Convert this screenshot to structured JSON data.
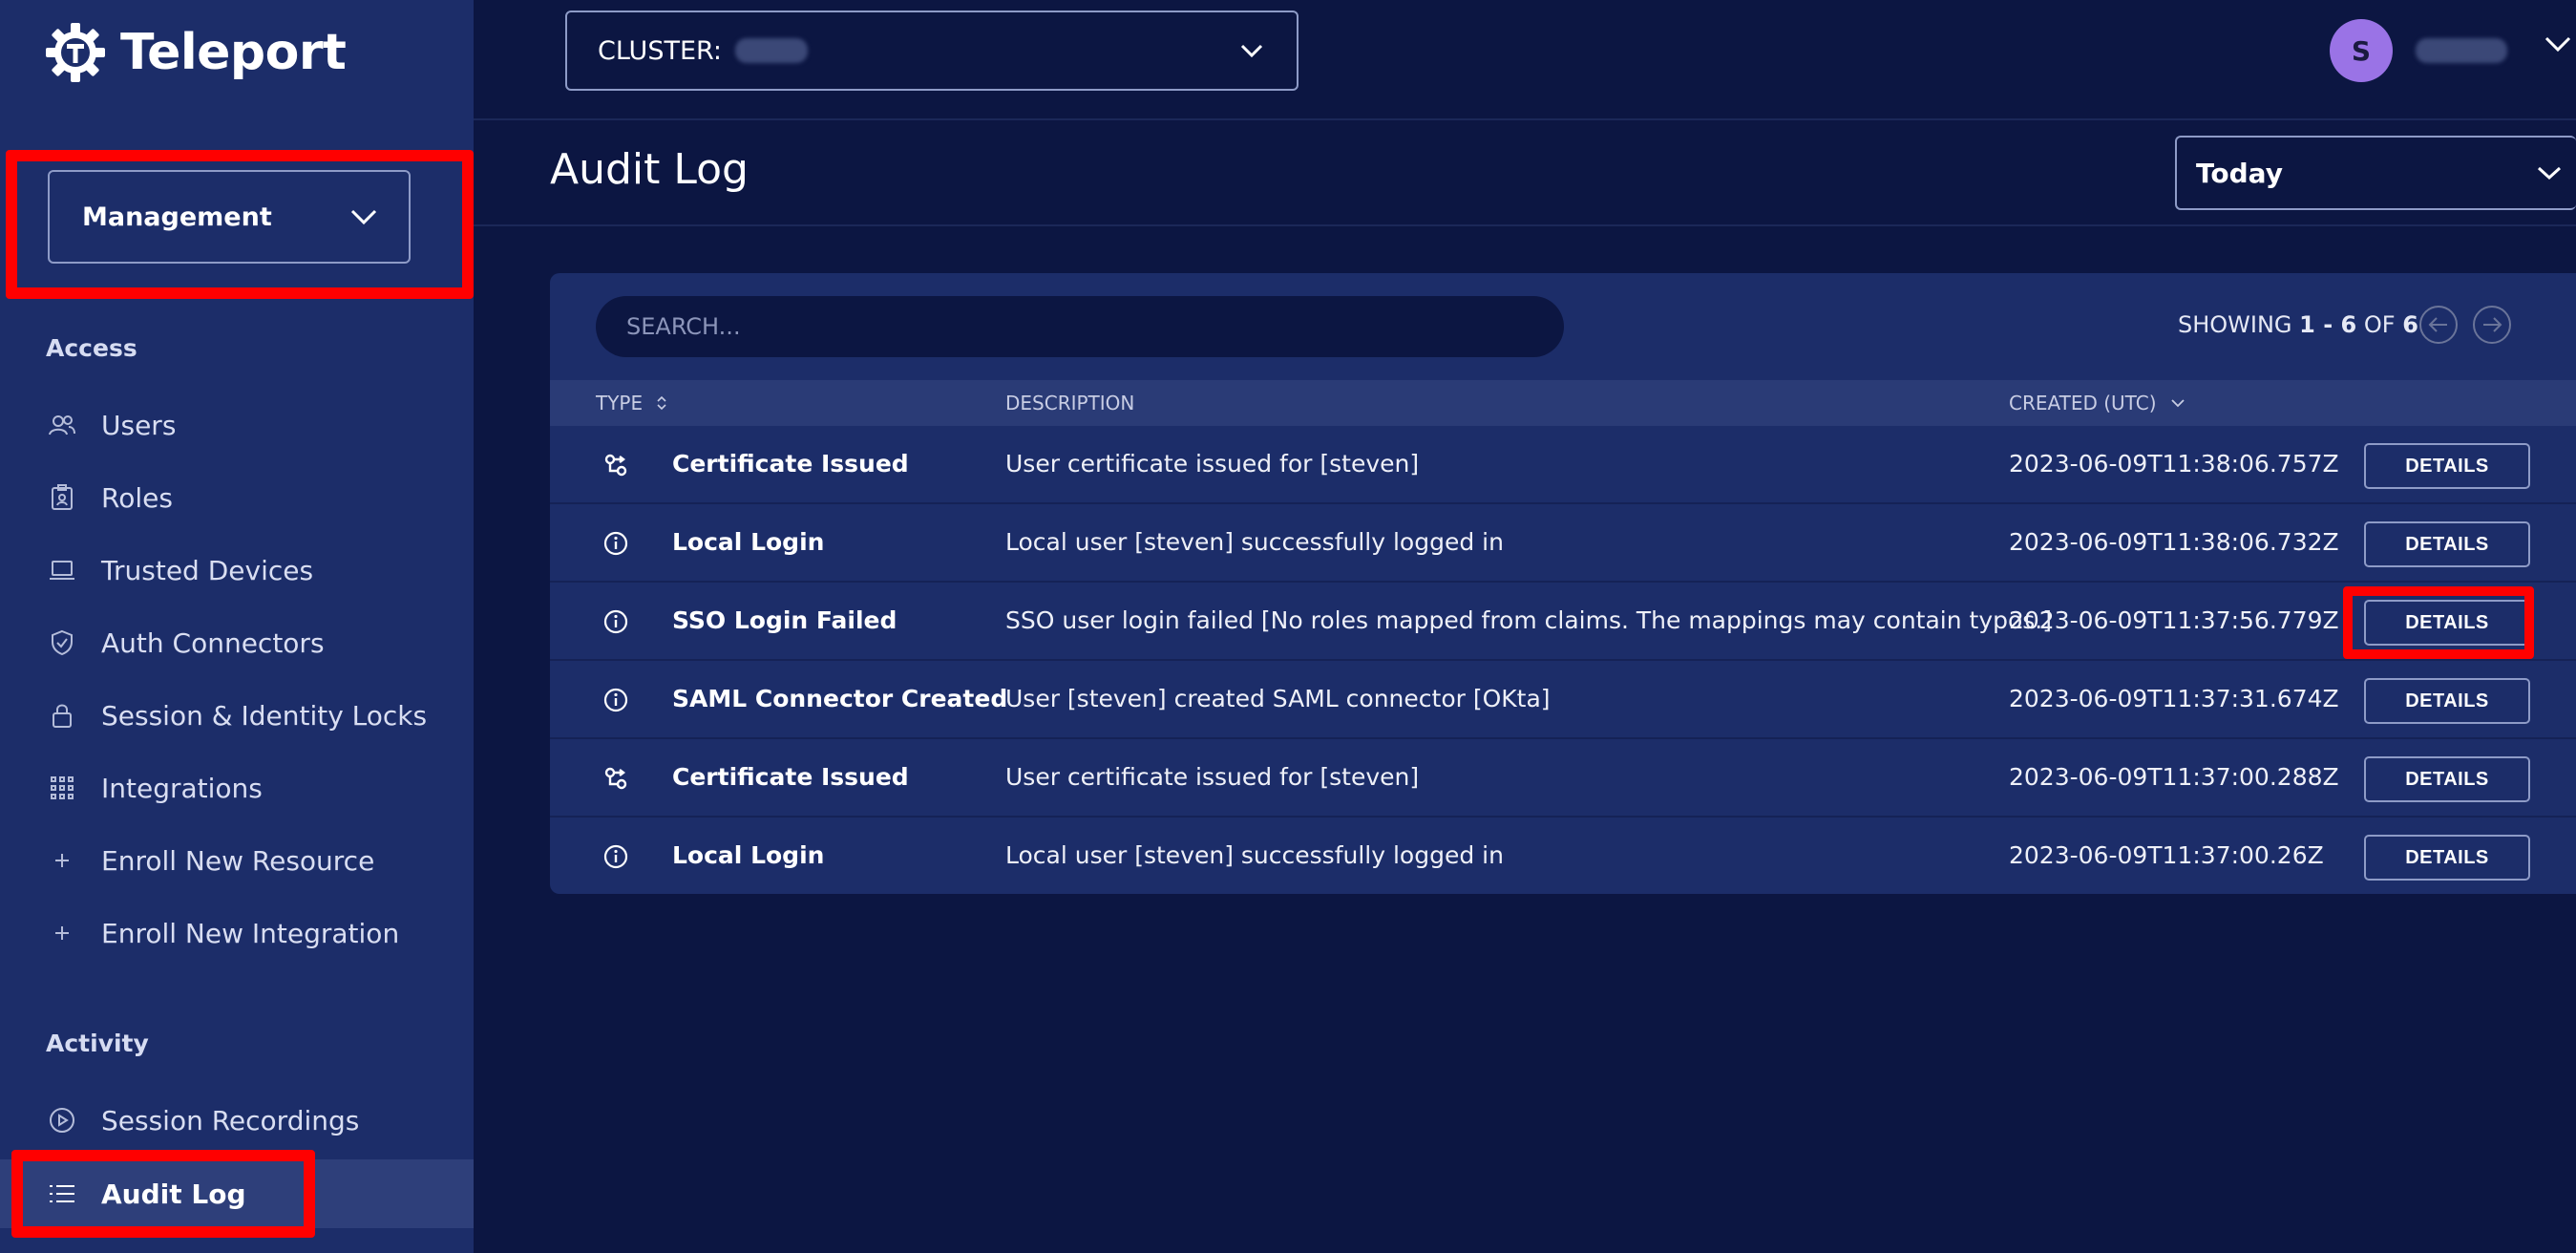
{
  "brand": {
    "name": "Teleport",
    "logo_icon": "teleport-gear-logo"
  },
  "sidebar": {
    "view_selector": "Management",
    "sections": [
      {
        "title": "Access",
        "items": [
          {
            "label": "Users",
            "icon": "users-icon"
          },
          {
            "label": "Roles",
            "icon": "roles-icon"
          },
          {
            "label": "Trusted Devices",
            "icon": "laptop-icon"
          },
          {
            "label": "Auth Connectors",
            "icon": "shield-icon"
          },
          {
            "label": "Session & Identity Locks",
            "icon": "lock-icon"
          },
          {
            "label": "Integrations",
            "icon": "grid-icon"
          },
          {
            "label": "Enroll New Resource",
            "icon": "plus-icon"
          },
          {
            "label": "Enroll New Integration",
            "icon": "plus-icon"
          }
        ]
      },
      {
        "title": "Activity",
        "items": [
          {
            "label": "Session Recordings",
            "icon": "play-circle-icon"
          },
          {
            "label": "Audit Log",
            "icon": "list-icon",
            "active": true
          }
        ]
      }
    ]
  },
  "topbar": {
    "cluster_label": "CLUSTER:",
    "avatar_initial": "S"
  },
  "header": {
    "title": "Audit Log",
    "range": "Today"
  },
  "table": {
    "search_placeholder": "SEARCH...",
    "showing": {
      "prefix": "SHOWING ",
      "range": "1 - 6",
      "mid": " OF ",
      "total": "6"
    },
    "columns": {
      "type": "TYPE",
      "description": "DESCRIPTION",
      "created": "CREATED (UTC)"
    },
    "details_label": "DETAILS",
    "rows": [
      {
        "icon": "certificate-icon",
        "type": "Certificate Issued",
        "description": "User certificate issued for [steven]",
        "created": "2023-06-09T11:38:06.757Z"
      },
      {
        "icon": "info-icon",
        "type": "Local Login",
        "description": "Local user [steven] successfully logged in",
        "created": "2023-06-09T11:38:06.732Z"
      },
      {
        "icon": "info-icon",
        "type": "SSO Login Failed",
        "description": "SSO user login failed [No roles mapped from claims. The mappings may contain typos.]",
        "created": "2023-06-09T11:37:56.779Z"
      },
      {
        "icon": "info-icon",
        "type": "SAML Connector Created",
        "description": "User [steven] created SAML connector [OKta]",
        "created": "2023-06-09T11:37:31.674Z"
      },
      {
        "icon": "certificate-icon",
        "type": "Certificate Issued",
        "description": "User certificate issued for [steven]",
        "created": "2023-06-09T11:37:00.288Z"
      },
      {
        "icon": "info-icon",
        "type": "Local Login",
        "description": "Local user [steven] successfully logged in",
        "created": "2023-06-09T11:37:00.26Z"
      }
    ]
  },
  "colors": {
    "background": "#0c1642",
    "sidebar": "#1c2d69",
    "highlight": "#ff0000",
    "avatar": "#9a73e6"
  }
}
